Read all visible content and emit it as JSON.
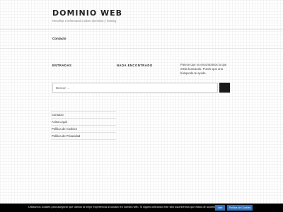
{
  "header": {
    "site_title": "DOMINIO WEB",
    "site_description": "Reseñas e información sobre dominios y hosting"
  },
  "nav": {
    "items": [
      {
        "label": "Contacto"
      }
    ]
  },
  "main": {
    "entries_title": "ENTRADAS",
    "not_found_title": "NADA ENCONTRADO",
    "not_found_text": "Parece que no encontramos lo que estás buscando. Puede que una búsqueda te ayude.",
    "search": {
      "placeholder": "Buscar …",
      "button_label": ""
    }
  },
  "footer": {
    "links": [
      {
        "label": "Contacto"
      },
      {
        "label": "Aviso Legal"
      },
      {
        "label": "Política de Cookies"
      },
      {
        "label": "Política de Privacidad"
      }
    ]
  },
  "cookie_bar": {
    "text": "Utilizamos cookies para asegurar que damos la mejor experiencia al usuario en nuestra web. Si sigues utilizando este sitio asumiremos que estás de acuerdo.",
    "accept_label": "Vale",
    "policy_label": "Política de Cookies"
  },
  "colors": {
    "accent_button": "#2e6fb8",
    "search_button": "#1a1a1a",
    "cookie_bar": "#000000"
  }
}
